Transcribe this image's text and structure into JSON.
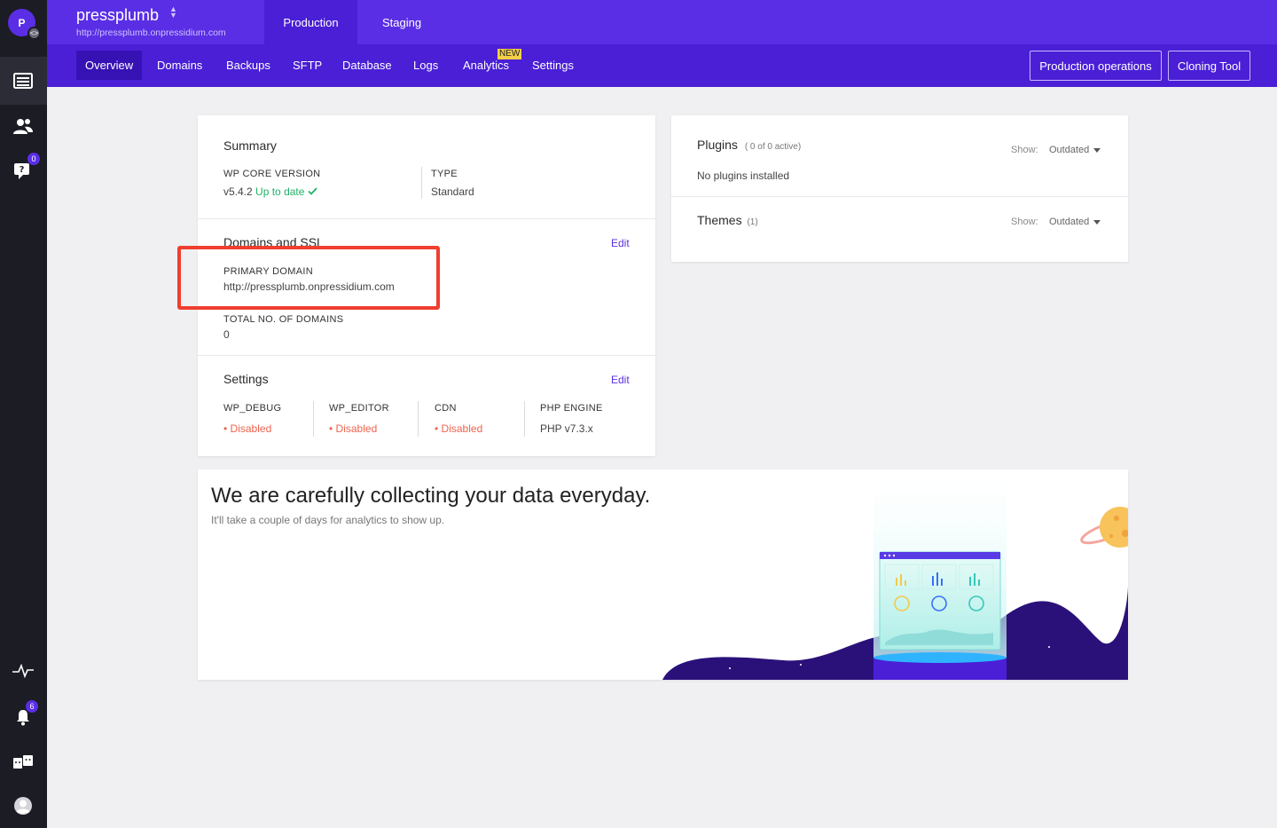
{
  "rail": {
    "avatar_letter": "P",
    "support_badge": "0",
    "notifications_badge": "6"
  },
  "site": {
    "name": "pressplumb",
    "url": "http://pressplumb.onpressidium.com"
  },
  "env_tabs": [
    {
      "label": "Production",
      "active": true
    },
    {
      "label": "Staging",
      "active": false
    }
  ],
  "nav": {
    "items": [
      "Overview",
      "Domains",
      "Backups",
      "SFTP",
      "Database",
      "Logs",
      "Analytics",
      "Settings"
    ],
    "active": "Overview",
    "new_badge": "NEW",
    "production_operations": "Production operations",
    "cloning_tool": "Cloning Tool"
  },
  "summary": {
    "title": "Summary",
    "wp_core_label": "WP CORE VERSION",
    "wp_core_version": "v5.4.2",
    "wp_core_status": "Up to date",
    "type_label": "TYPE",
    "type_value": "Standard"
  },
  "domains": {
    "title": "Domains and SSL",
    "edit": "Edit",
    "primary_label": "PRIMARY DOMAIN",
    "primary_value": "http://pressplumb.onpressidium.com",
    "total_label": "TOTAL NO. OF DOMAINS",
    "total_value": "0"
  },
  "settings": {
    "title": "Settings",
    "edit": "Edit",
    "wp_debug_label": "WP_DEBUG",
    "wp_debug_value": "Disabled",
    "wp_editor_label": "WP_EDITOR",
    "wp_editor_value": "Disabled",
    "cdn_label": "CDN",
    "cdn_value": "Disabled",
    "php_label": "PHP ENGINE",
    "php_value": "PHP v7.3.x"
  },
  "plugins": {
    "title": "Plugins",
    "count": "( 0 of 0 active)",
    "empty": "No plugins installed",
    "show_label": "Show:",
    "show_value": "Outdated"
  },
  "themes": {
    "title": "Themes",
    "count": "(1)",
    "show_label": "Show:",
    "show_value": "Outdated"
  },
  "analytics_banner": {
    "title": "We are carefully collecting your data everyday.",
    "subtitle": "It'll take a couple of days for analytics to show up."
  },
  "colors": {
    "brand": "#5a2ee5",
    "brand_dark": "#4a1fd6",
    "rail": "#1c1c24",
    "status_ok": "#20b267",
    "status_disabled": "#f0624d",
    "highlight": "#f03e2f"
  }
}
